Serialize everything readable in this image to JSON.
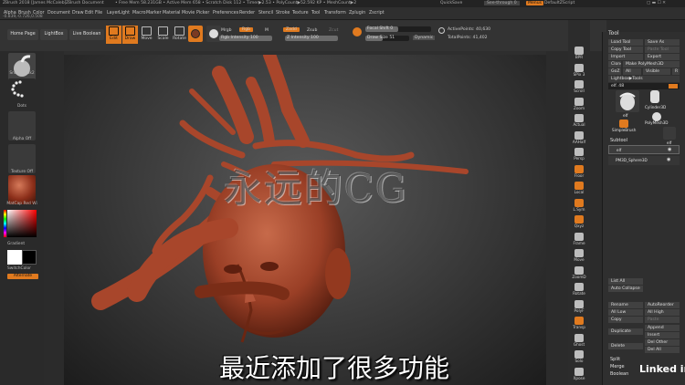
{
  "titlebar": {
    "app": "ZBrush 2018 [James McCaleb]",
    "doc": "ZBrush Document",
    "stats": "• Free Mem 58.231GB • Active Mem 658 • Scratch Disk 112 • Timer▶2.53 • PolyCount▶52.592 KP • MeshCount▶2",
    "quicksave": "QuickSave",
    "seethrough": "See-through 0",
    "menus": "Menus",
    "script": "DefaultZScript"
  },
  "menubar": {
    "items": [
      "Alpha",
      "Brush",
      "Color",
      "Document",
      "Draw",
      "Edit",
      "File",
      "Layer",
      "Light",
      "Macro",
      "Marker",
      "Material",
      "Movie",
      "Picker",
      "Preferences",
      "Render",
      "Stencil",
      "Stroke",
      "Texture",
      "Tool",
      "Transform",
      "Zplugin",
      "Zscript"
    ],
    "coords": "-0.839,-0.726,0.508"
  },
  "toolbar": {
    "home_page": "Home Page",
    "lightbox": "LightBox",
    "live_boolean": "Live Boolean",
    "buttons": [
      "Edit",
      "Draw",
      "Move",
      "Scale",
      "Rotate"
    ],
    "mrgb": "Mrgb",
    "rgb": "Rgb",
    "m": "M",
    "rgb_intensity": "Rgb Intensity 100",
    "zadd": "Zadd",
    "zsub": "Zsub",
    "zcut": "Zcut",
    "z_intensity": "Z Intensity 100",
    "focal_shift": "Focal Shift 0",
    "draw_size": "Draw Size 51",
    "dynamic": "Dynamic",
    "active_points": "ActivePoints: 40,630",
    "total_points": "TotalPoints: 41,402"
  },
  "leftshelf": {
    "brush_label": "SnakeHook2",
    "stroke_label": "Dots",
    "alpha_label": "Alpha Off",
    "texture_label": "Texture Off",
    "material_label": "MatCap Red Wi",
    "gradient_label": "Gradient",
    "switch_label": "SwitchColor",
    "alternate_label": "Alternate"
  },
  "canvas": {
    "watermark": "永远的CG",
    "subtitle": "最近添加了很多功能"
  },
  "rightdock": {
    "items": [
      "BPR",
      "SPix 3",
      "Scroll",
      "Zoom",
      "Actual",
      "AAHalf",
      "Persp",
      "Floor",
      "Local",
      "L.Sym",
      "Qxyz",
      "Frame",
      "Move",
      "ZoomD",
      "Rotate",
      "PolyF",
      "Transp",
      "Ghost",
      "Solo",
      "Xpose"
    ]
  },
  "toolpanel": {
    "title": "Tool",
    "load_tool": "Load Tool",
    "save_as": "Save As",
    "copy_tool": "Copy Tool",
    "paste_tool": "Paste Tool",
    "import": "Import",
    "export": "Export",
    "clone": "Clone",
    "make_polymesh": "Make PolyMesh3D",
    "goz": "GoZ",
    "all": "All",
    "visible": "Visible",
    "r": "R",
    "lightbox_tools": "Lightbox▶Tools",
    "current_tool": "elf. 48",
    "tool_thumbs": [
      "elf",
      "Cylinder3D",
      "PolyMesh3D",
      "SimpleBrush",
      "elf"
    ],
    "subtool": "Subtool",
    "subtool_items": [
      "elf",
      "PM3D_Sphere3D"
    ],
    "list_all": "List All",
    "auto_collapse": "Auto Collapse",
    "rename": "Rename",
    "auto_reorder": "AutoReorder",
    "all_low": "All Low",
    "all_high": "All High",
    "copy": "Copy",
    "paste": "Paste",
    "duplicate": "Duplicate",
    "append": "Append",
    "insert": "Insert",
    "delete": "Delete",
    "del_other": "Del Other",
    "del_all": "Del All",
    "split": "Split",
    "merge": "Merge",
    "boolean": "Boolean"
  },
  "brand": "Linked in",
  "colors": {
    "accent": "#e07a1f",
    "clay": "#a8462b",
    "panel": "#2f2f2f"
  }
}
